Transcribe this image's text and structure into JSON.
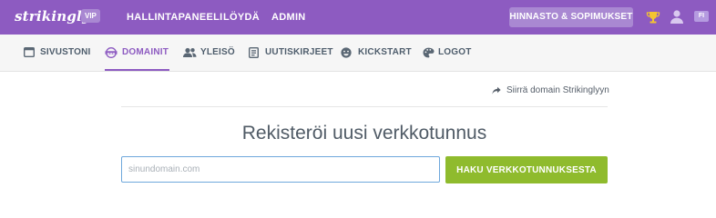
{
  "brand": {
    "logo_text": "strikingly",
    "badge": "VIP"
  },
  "topnav": {
    "items": [
      "HALLINTAPANEELI",
      "LÖYDÄ",
      "ADMIN"
    ],
    "pricing_button": "HINNASTO & SOPIMUKSET",
    "language": "FI",
    "icons": [
      "trophy-icon",
      "user-icon"
    ]
  },
  "subnav": {
    "tabs": [
      {
        "label": "SIVUSTONI",
        "icon": "browser-window-icon",
        "active": false
      },
      {
        "label": "DOMAINIT",
        "icon": "www-globe-icon",
        "active": true
      },
      {
        "label": "YLEISÖ",
        "icon": "users-icon",
        "active": false
      },
      {
        "label": "UUTISKIRJEET",
        "icon": "newsletter-icon",
        "active": false
      },
      {
        "label": "KICKSTART",
        "icon": "smiley-icon",
        "active": false
      },
      {
        "label": "LOGOT",
        "icon": "palette-icon",
        "active": false
      }
    ]
  },
  "main": {
    "transfer_link": "Siirrä domain Strikinglyyn",
    "heading": "Rekisteröi uusi verkkotunnus",
    "search_input": {
      "placeholder": "sinundomain.com",
      "value": ""
    },
    "search_button": "HAKU VERKKOTUNNUKSESTA"
  },
  "colors": {
    "topbar": "#8d5bc1",
    "accent": "#8d5bc1",
    "button_green": "#8fbb2d",
    "tab_text": "#4e5d6c",
    "input_border": "#6fa8dc"
  }
}
